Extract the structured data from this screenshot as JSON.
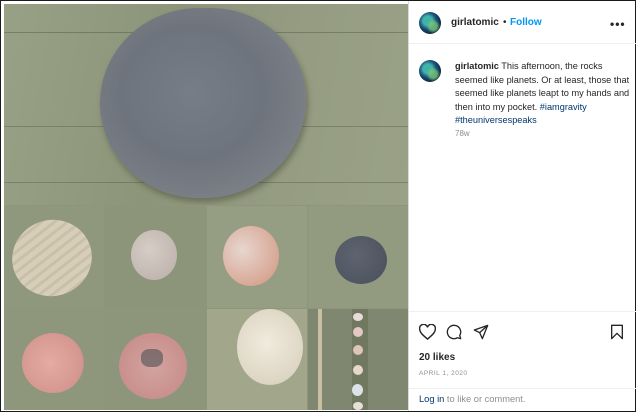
{
  "post": {
    "username": "girlatomic",
    "separator": "•",
    "follow_label": "Follow",
    "more_label": "•••",
    "caption_text": "This afternoon, the rocks seemed like planets. Or at least, those that seemed like planets leapt to my hands and then into my pocket.",
    "hashtags": "#iamgravity #theuniversespeaks",
    "time_ago": "78w",
    "likes": "20 likes",
    "date": "APRIL 1, 2020",
    "login_link": "Log in",
    "login_suffix": " to like or comment."
  },
  "icons": {
    "like": "heart-icon",
    "comment": "comment-icon",
    "share": "share-icon",
    "save": "bookmark-icon",
    "more": "more-options-icon"
  },
  "colors": {
    "accent": "#0095f6",
    "link": "#00376b",
    "text": "#262626",
    "muted": "#8e8e8e"
  }
}
